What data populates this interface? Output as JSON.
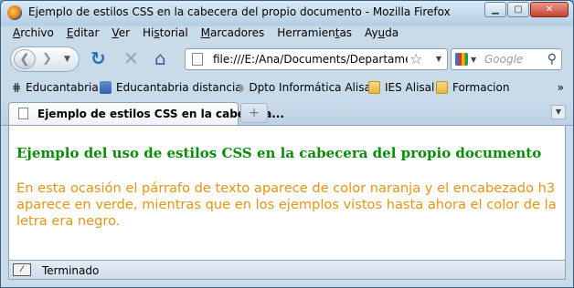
{
  "window": {
    "title": "Ejemplo de estilos CSS en la cabecera del propio documento - Mozilla Firefox",
    "app_icon": "firefox-icon",
    "controls": [
      "minimize",
      "maximize",
      "close"
    ]
  },
  "menubar": {
    "items": [
      {
        "label": "Archivo",
        "mnemonic": "A",
        "rest": "rchivo"
      },
      {
        "label": "Editar",
        "mnemonic": "E",
        "rest": "ditar"
      },
      {
        "label": "Ver",
        "mnemonic": "V",
        "rest": "er"
      },
      {
        "label": "Historial",
        "pre": "Hi",
        "mnemonic": "s",
        "rest": "torial"
      },
      {
        "label": "Marcadores",
        "mnemonic": "M",
        "rest": "arcadores"
      },
      {
        "label": "Herramientas",
        "pre": "Herramien",
        "mnemonic": "t",
        "rest": "as"
      },
      {
        "label": "Ayuda",
        "pre": "Ay",
        "mnemonic": "u",
        "rest": "da"
      }
    ]
  },
  "navbar": {
    "url": "file:///E:/Ana/Documents/Departament",
    "search_placeholder": "Google",
    "search_engine_icon": "google-icon"
  },
  "bookmarks": {
    "items": [
      {
        "label": "Educantabria",
        "icon": "educantabria-icon"
      },
      {
        "label": "Educantabria distancia",
        "icon": "page-icon"
      },
      {
        "label": "Dpto Informática Alisal",
        "icon": "bookmark-icon"
      },
      {
        "label": "IES Alisal",
        "icon": "folder-icon"
      },
      {
        "label": "Formacion",
        "icon": "folder-icon"
      }
    ],
    "overflow": "»"
  },
  "tabs": {
    "active_label": "Ejemplo de estilos CSS en la cabecera..."
  },
  "content": {
    "heading": "Ejemplo del uso de estilos CSS en la cabecera del propio documento",
    "heading_color": "#0a8c0a",
    "paragraph": "En esta ocasión el párrafo de texto aparece de color naranja y el encabezado h3 aparece en verde, mientras que en los ejemplos vistos hasta ahora el color de la letra era negro.",
    "paragraph_color": "#e49611"
  },
  "status": {
    "text": "Terminado"
  }
}
